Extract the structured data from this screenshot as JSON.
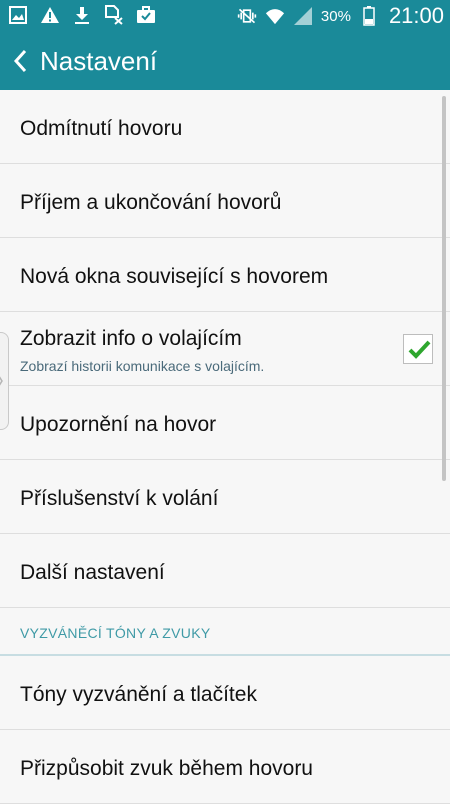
{
  "status_bar": {
    "battery_percent": "30%",
    "time": "21:00",
    "icons_left": [
      "gallery-icon",
      "warning-icon",
      "download-icon",
      "sim-card-off-icon",
      "briefcase-check-icon"
    ],
    "icons_right": [
      "vibrate-mute-icon",
      "wifi-icon",
      "signal-icon",
      "battery-icon"
    ]
  },
  "header": {
    "title": "Nastavení"
  },
  "list": {
    "items": [
      {
        "title": "Odmítnutí hovoru"
      },
      {
        "title": "Příjem a ukončování hovorů"
      },
      {
        "title": "Nová okna související s hovorem"
      },
      {
        "title": "Zobrazit info o volajícím",
        "subtitle": "Zobrazí historii komunikace s volajícím.",
        "checked": true
      },
      {
        "title": "Upozornění na hovor"
      },
      {
        "title": "Příslušenství k volání"
      },
      {
        "title": "Další nastavení"
      }
    ],
    "section": {
      "label": "VYZVÁNĚCÍ TÓNY A ZVUKY"
    },
    "items2": [
      {
        "title": "Tóny vyzvánění a tlačítek"
      },
      {
        "title": "Přizpůsobit zvuk během hovoru"
      }
    ]
  },
  "colors": {
    "accent": "#1a8a99",
    "check": "#2ea62e",
    "section_text": "#3f9aa6"
  }
}
